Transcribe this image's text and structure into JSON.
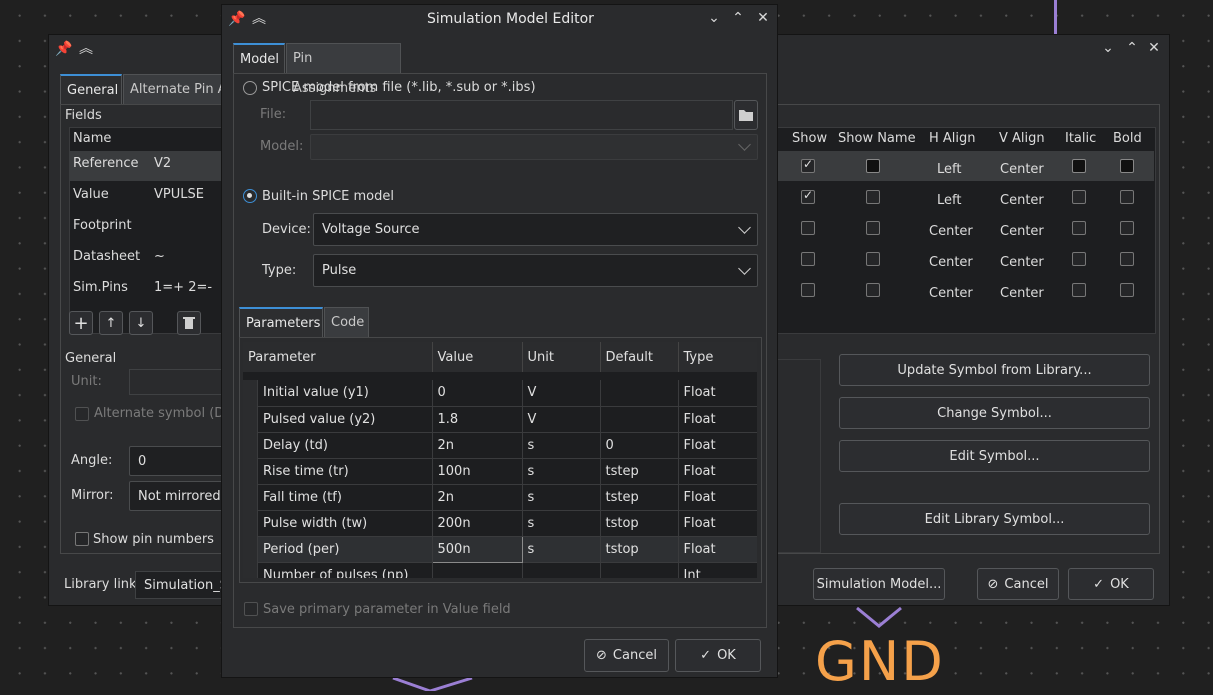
{
  "background": {
    "gnd_label": "GND"
  },
  "symbol_props": {
    "tabs": [
      "General",
      "Alternate Pin A"
    ],
    "fields_group": "Fields",
    "name_header": "Name",
    "rows": [
      {
        "name": "Reference",
        "value": "V2",
        "show": true,
        "show_name": "black",
        "h_align": "Left",
        "v_align": "Center",
        "italic": "black",
        "bold": "black"
      },
      {
        "name": "Value",
        "value": "VPULSE",
        "show": true,
        "show_name": "empty",
        "h_align": "Left",
        "v_align": "Center",
        "italic": "empty",
        "bold": "empty"
      },
      {
        "name": "Footprint",
        "value": "",
        "show": false,
        "show_name": "empty",
        "h_align": "Center",
        "v_align": "Center",
        "italic": "empty",
        "bold": "empty"
      },
      {
        "name": "Datasheet",
        "value": "~",
        "show": false,
        "show_name": "empty",
        "h_align": "Center",
        "v_align": "Center",
        "italic": "empty",
        "bold": "empty"
      },
      {
        "name": "Sim.Pins",
        "value": "1=+ 2=-",
        "show": false,
        "show_name": "empty",
        "h_align": "Center",
        "v_align": "Center",
        "italic": "empty",
        "bold": "empty"
      }
    ],
    "col_headers": [
      "Show",
      "Show Name",
      "H Align",
      "V Align",
      "Italic",
      "Bold"
    ],
    "toolbar_icons": [
      "+",
      "↑",
      "↓",
      "🗑"
    ],
    "general_group": "General",
    "unit_label": "Unit:",
    "alt_symbol_label": "Alternate symbol (De",
    "angle_label": "Angle:",
    "angle_value": "0",
    "mirror_label": "Mirror:",
    "mirror_value": "Not mirrored",
    "show_pin_numbers": "Show pin numbers",
    "library_link_label": "Library link:",
    "library_link_value": "Simulation_SF",
    "buttons": {
      "update_symbol": "Update Symbol from Library...",
      "change_symbol": "Change Symbol...",
      "edit_symbol": "Edit Symbol...",
      "edit_library_symbol": "Edit Library Symbol...",
      "simulation_model": "Simulation Model...",
      "cancel": "Cancel",
      "ok": "OK"
    }
  },
  "dialog": {
    "title": "Simulation Model Editor",
    "tabs": [
      "Model",
      "Pin Assignments"
    ],
    "spice_file_radio": "SPICE model from file (*.lib, *.sub or *.ibs)",
    "file_label": "File:",
    "model_label": "Model:",
    "builtin_radio": "Built-in SPICE model",
    "device_label": "Device:",
    "device_value": "Voltage Source",
    "type_label": "Type:",
    "type_value": "Pulse",
    "subtabs": [
      "Parameters",
      "Code"
    ],
    "param_headers": [
      "Parameter",
      "Value",
      "Unit",
      "Default",
      "Type"
    ],
    "params": [
      {
        "parameter": "Initial value (y1)",
        "value": "0",
        "unit": "V",
        "default": "",
        "type": "Float"
      },
      {
        "parameter": "Pulsed value (y2)",
        "value": "1.8",
        "unit": "V",
        "default": "",
        "type": "Float"
      },
      {
        "parameter": "Delay (td)",
        "value": "2n",
        "unit": "s",
        "default": "0",
        "type": "Float"
      },
      {
        "parameter": "Rise time (tr)",
        "value": "100n",
        "unit": "s",
        "default": "tstep",
        "type": "Float"
      },
      {
        "parameter": "Fall time (tf)",
        "value": "2n",
        "unit": "s",
        "default": "tstep",
        "type": "Float"
      },
      {
        "parameter": "Pulse width (tw)",
        "value": "200n",
        "unit": "s",
        "default": "tstop",
        "type": "Float"
      },
      {
        "parameter": "Period (per)",
        "value": "500n",
        "unit": "s",
        "default": "tstop",
        "type": "Float"
      },
      {
        "parameter": "Number of pulses (np)",
        "value": "",
        "unit": "",
        "default": "",
        "type": "Int"
      }
    ],
    "save_primary": "Save primary parameter in Value field",
    "cancel_label": "Cancel",
    "ok_label": "OK"
  },
  "colors": {
    "accent": "#3d8fd6",
    "gnd": "#f5a14a",
    "wire": "#9b7fd4"
  }
}
